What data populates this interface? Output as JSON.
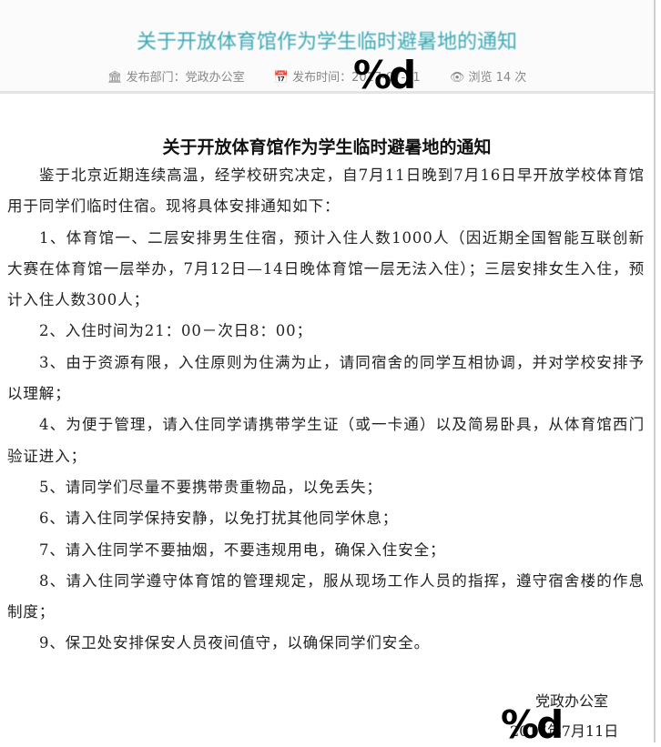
{
  "web_header": {
    "title": "关于开放体育馆作为学生临时避暑地的通知",
    "department": "发布部门：党政办公室",
    "publish_time": "发布时间：2017-07-11",
    "views": "浏览 14 次"
  },
  "document": {
    "title": "关于开放体育馆作为学生临时避暑地的通知",
    "paragraphs": [
      "鉴于北京近期连续高温，经学校研究决定，自7月11日晚到7月16日早开放学校体育馆用于同学们临时住宿。现将具体安排通知如下：",
      "1、体育馆一、二层安排男生住宿，预计入住人数1000人（因近期全国智能互联创新大赛在体育馆一层举办，7月12日—14日晚体育馆一层无法入住）；三层安排女生入住，预计入住人数300人；",
      "2、入住时间为21：00－次日8：00；",
      "3、由于资源有限，入住原则为住满为止，请同宿舍的同学互相协调，并对学校安排予以理解；",
      "4、为便于管理，请入住同学请携带学生证（或一卡通）以及简易卧具，从体育馆西门验证进入；",
      "5、请同学们尽量不要携带贵重物品，以免丢失；",
      "6、请入住同学保持安静，以免打扰其他同学休息；",
      "7、请入住同学不要抽烟，不要违规用电，确保入住安全；",
      "8、请入住同学遵守体育馆的管理规定，服从现场工作人员的指挥，遵守宿舍楼的作息制度；",
      "9、保卫处安排保安人员夜间值守，以确保同学们安全。"
    ],
    "signature": "党政办公室",
    "date": "2017年7月11日"
  },
  "watermarks": [
    "%d",
    "%d"
  ]
}
